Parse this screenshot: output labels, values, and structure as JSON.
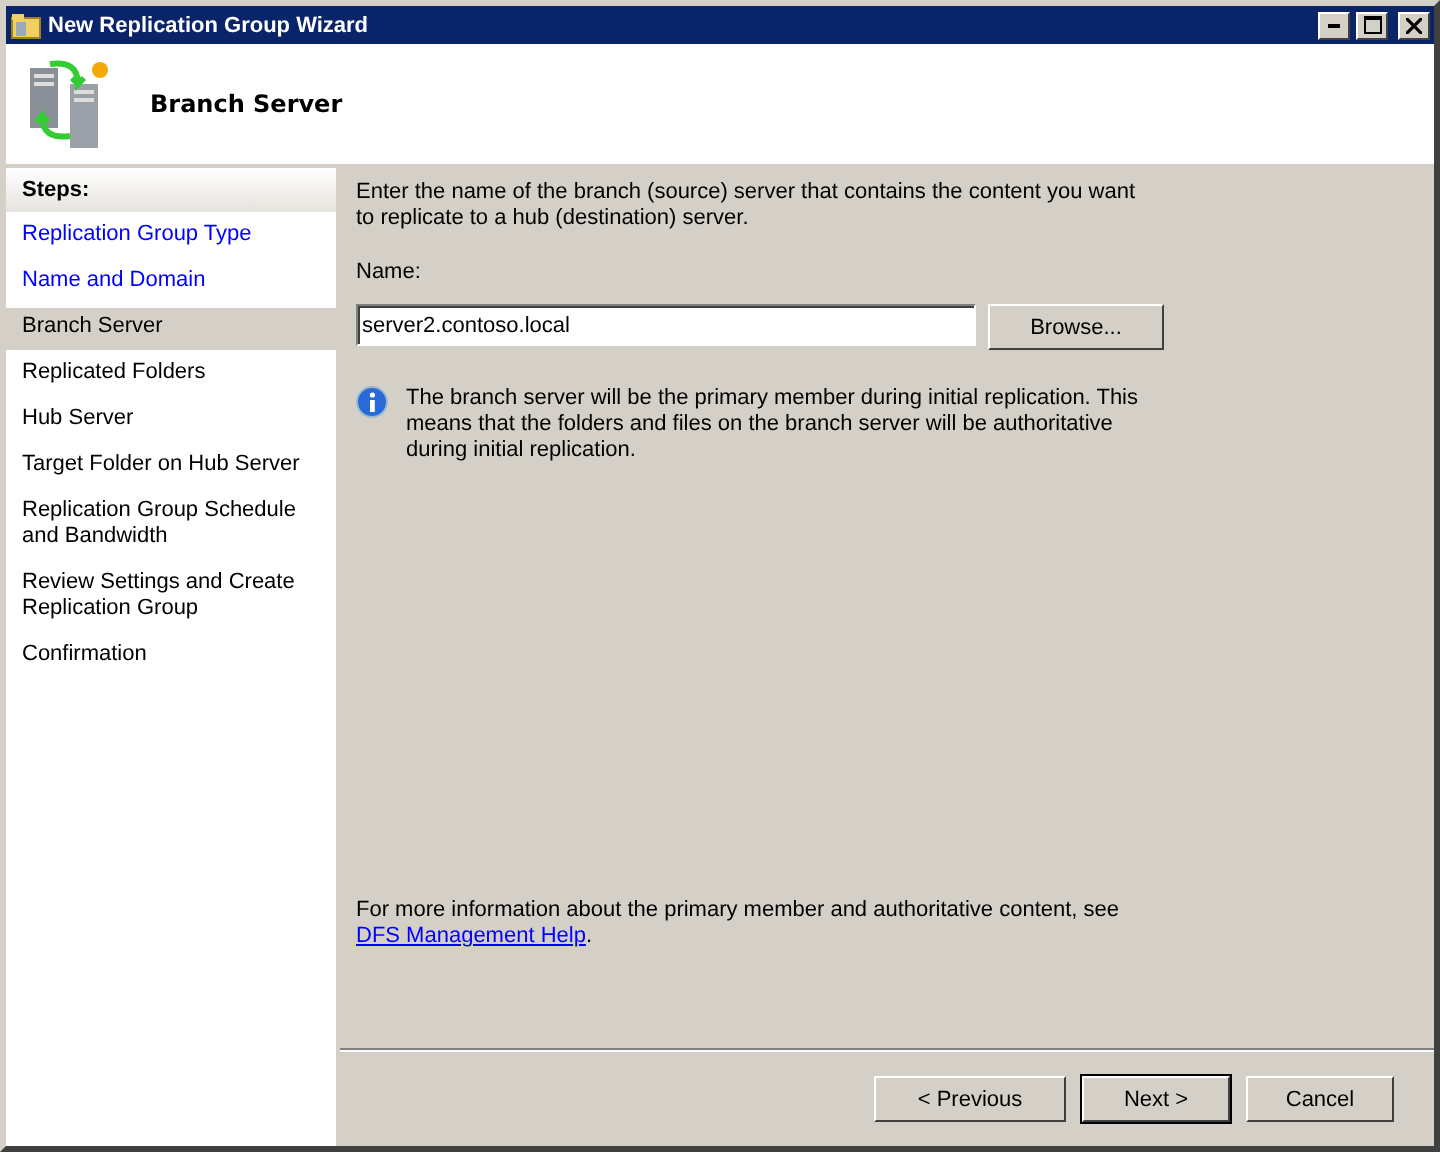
{
  "window": {
    "title": "New Replication Group Wizard"
  },
  "header": {
    "title": "Branch Server"
  },
  "steps": {
    "heading": "Steps:",
    "items": [
      {
        "label": "Replication Group Type",
        "completed": true,
        "selected": false
      },
      {
        "label": "Name and Domain",
        "completed": true,
        "selected": false
      },
      {
        "label": "Branch Server",
        "completed": false,
        "selected": true
      },
      {
        "label": "Replicated Folders",
        "completed": false,
        "selected": false
      },
      {
        "label": "Hub Server",
        "completed": false,
        "selected": false
      },
      {
        "label": "Target Folder on Hub Server",
        "completed": false,
        "selected": false
      },
      {
        "label": "Replication Group Schedule and Bandwidth",
        "completed": false,
        "selected": false
      },
      {
        "label": "Review Settings and Create Replication Group",
        "completed": false,
        "selected": false
      },
      {
        "label": "Confirmation",
        "completed": false,
        "selected": false
      }
    ]
  },
  "content": {
    "intro": "Enter the name of the branch (source) server that contains the content you want to replicate to a hub (destination) server.",
    "name_label": "Name:",
    "name_value": "server2.contoso.local",
    "browse": "Browse...",
    "info": "The branch server will be the primary member during initial replication. This means that the folders and files on the branch server will be authoritative during initial replication.",
    "help": {
      "text": "For more information about the primary member and authoritative content, see",
      "link": "DFS Management Help",
      "suffix": "."
    }
  },
  "buttons": [
    {
      "label": "< Previous",
      "default": false
    },
    {
      "label": "Next >",
      "default": true
    },
    {
      "label": "Cancel",
      "default": false
    }
  ]
}
